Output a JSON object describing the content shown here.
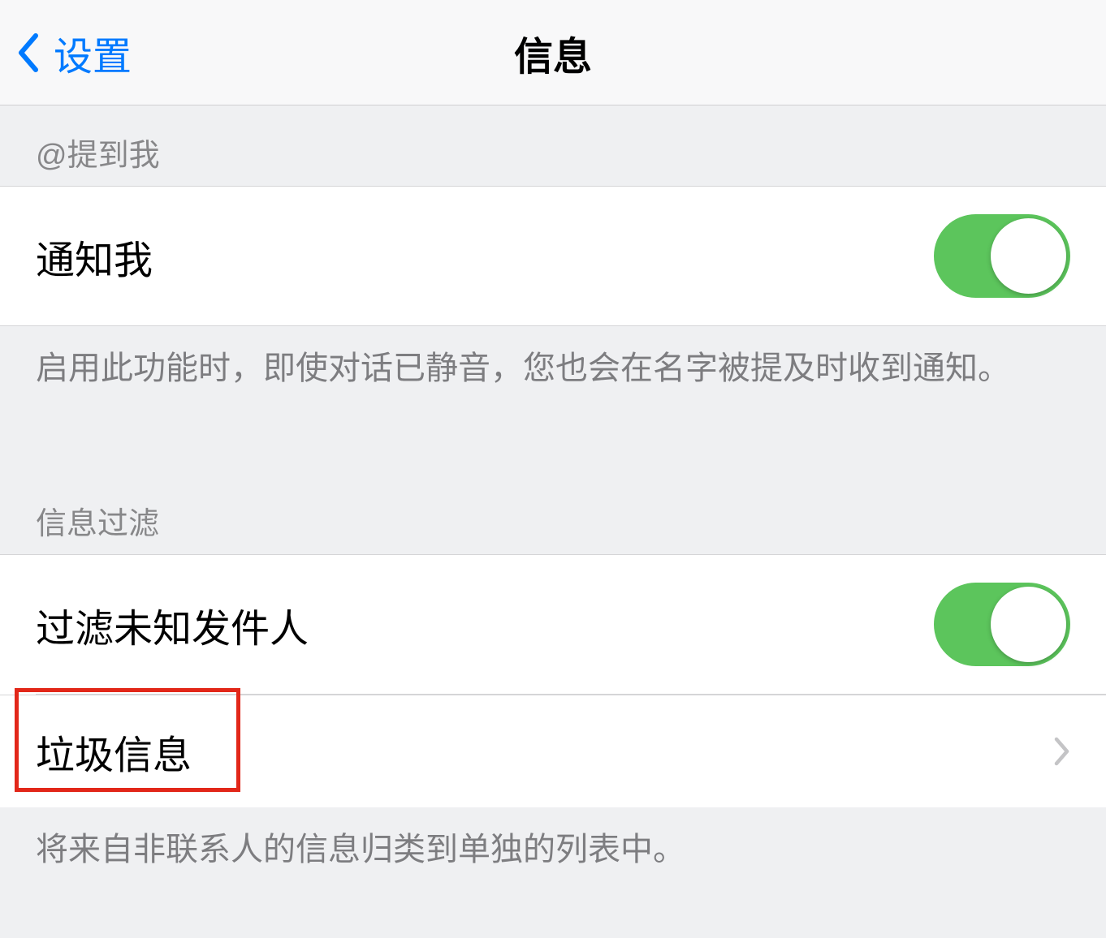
{
  "header": {
    "back_label": "设置",
    "title": "信息"
  },
  "sections": {
    "mention": {
      "header": "@提到我",
      "notify_me_label": "通知我",
      "notify_me_on": true,
      "description": "启用此功能时，即使对话已静音，您也会在名字被提及时收到通知。"
    },
    "filter": {
      "header": "信息过滤",
      "filter_unknown_label": "过滤未知发件人",
      "filter_unknown_on": true,
      "spam_label": "垃圾信息",
      "description": "将来自非联系人的信息归类到单独的列表中。"
    }
  }
}
